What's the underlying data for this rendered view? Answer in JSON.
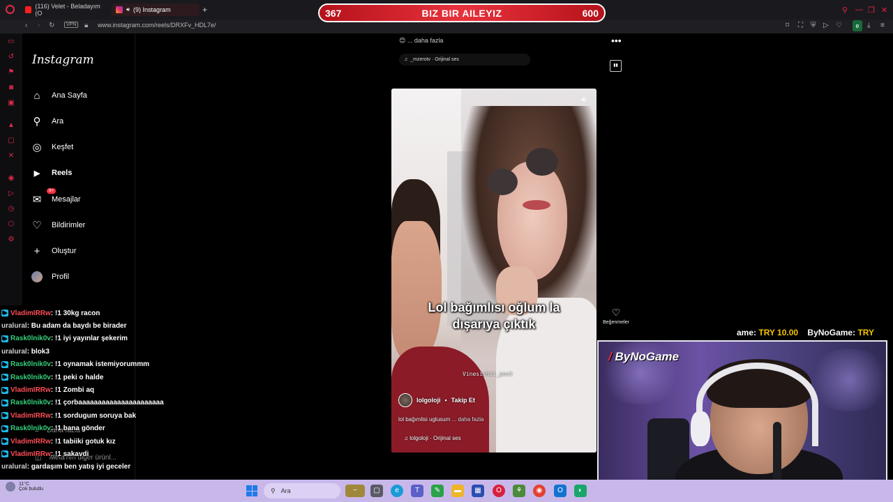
{
  "browser": {
    "tabs": [
      {
        "title": "(116) Velet - Beladayım (O",
        "icon": "youtube-icon"
      },
      {
        "title": "(9) Instagram",
        "icon": "instagram-icon"
      }
    ],
    "url": "www.instagram.com/reels/DRXFv_HDL7e/",
    "vpn_label": "VPN",
    "extension_label": "e"
  },
  "overlay_bar": {
    "left": "367",
    "center": "BIZ BIR AILEYIZ",
    "right": "600"
  },
  "instagram": {
    "logo": "Instagram",
    "nav": [
      {
        "label": "Ana Sayfa",
        "icon": "home-icon",
        "glyph": "⌂"
      },
      {
        "label": "Ara",
        "icon": "search-icon",
        "glyph": "⚲"
      },
      {
        "label": "Keşfet",
        "icon": "compass-icon",
        "glyph": "◎"
      },
      {
        "label": "Reels",
        "icon": "reels-icon",
        "glyph": "▶"
      },
      {
        "label": "Mesajlar",
        "icon": "messenger-icon",
        "glyph": "✉"
      },
      {
        "label": "Bildirimler",
        "icon": "heart-icon",
        "glyph": "♡"
      },
      {
        "label": "Oluştur",
        "icon": "plus-icon",
        "glyph": "+"
      },
      {
        "label": "Profil",
        "icon": "avatar",
        "glyph": ""
      }
    ],
    "messages_badge": "9+",
    "more_label": "Daha fazla",
    "meta_label": "Meta'nın diğer ürünl..."
  },
  "reel": {
    "top_text": "... daha fazla",
    "top_audio": "_mzerotv · Orijinal ses",
    "caption_line1": "Lol bağımlısı oğlum la",
    "caption_line2": "dışarıya çıktık",
    "watermark": "Vinesishit_post",
    "author": "lolgoloji",
    "follow_label": "Takip Et",
    "description": "lol bağımlisi uglusum",
    "description_more": "... daha fazla",
    "audio": "lolgoloji · Orijinal ses",
    "like_label": "Beğenmeler"
  },
  "ticker": {
    "prefix": "ame: ",
    "amount": "TRY 10.00",
    "second_prefix": "ByNoGame: ",
    "second_amount": "TRY"
  },
  "webcam": {
    "brand_slash": "/",
    "brand": "ByNoGame"
  },
  "chat": [
    {
      "user": "VladimIRRw",
      "color": "u1",
      "text": ": !1 30kg racon",
      "badge": true
    },
    {
      "user": "uralural",
      "color": "u3",
      "text": ": Bu adam da baydı be birader",
      "badge": false
    },
    {
      "user": "Rask0lnik0v",
      "color": "u2",
      "text": ": !1 iyi yayınlar şekerim",
      "badge": true
    },
    {
      "user": "uralural",
      "color": "u3",
      "text": ": blok3",
      "badge": false
    },
    {
      "user": "Rask0lnik0v",
      "color": "u2",
      "text": ": !1 oynamak istemiyorummm",
      "badge": true
    },
    {
      "user": "Rask0lnik0v",
      "color": "u2",
      "text": ": !1 peki o halde",
      "badge": true
    },
    {
      "user": "VladimIRRw",
      "color": "u1",
      "text": ": !1 Zombi aq",
      "badge": true
    },
    {
      "user": "Rask0lnik0v",
      "color": "u2",
      "text": ": !1 çorbaaaaaaaaaaaaaaaaaaaaaa",
      "badge": true
    },
    {
      "user": "VladimIRRw",
      "color": "u1",
      "text": ": !1 sordugum soruya bak",
      "badge": true
    },
    {
      "user": "Rask0lnik0v",
      "color": "u2",
      "text": ": !1 bana gönder",
      "badge": true
    },
    {
      "user": "VladimIRRw",
      "color": "u1",
      "text": ": !1 tabiiki gotuk kız",
      "badge": true
    },
    {
      "user": "VladimIRRw",
      "color": "u1",
      "text": ": !1 sakavdi",
      "badge": true
    },
    {
      "user": "uralural",
      "color": "u3",
      "text": ": gardaşım ben yatış iyi geceler",
      "badge": false
    }
  ],
  "taskbar": {
    "temperature": "11°C",
    "weather": "Çok bulutlu",
    "search_label": "Ara"
  }
}
